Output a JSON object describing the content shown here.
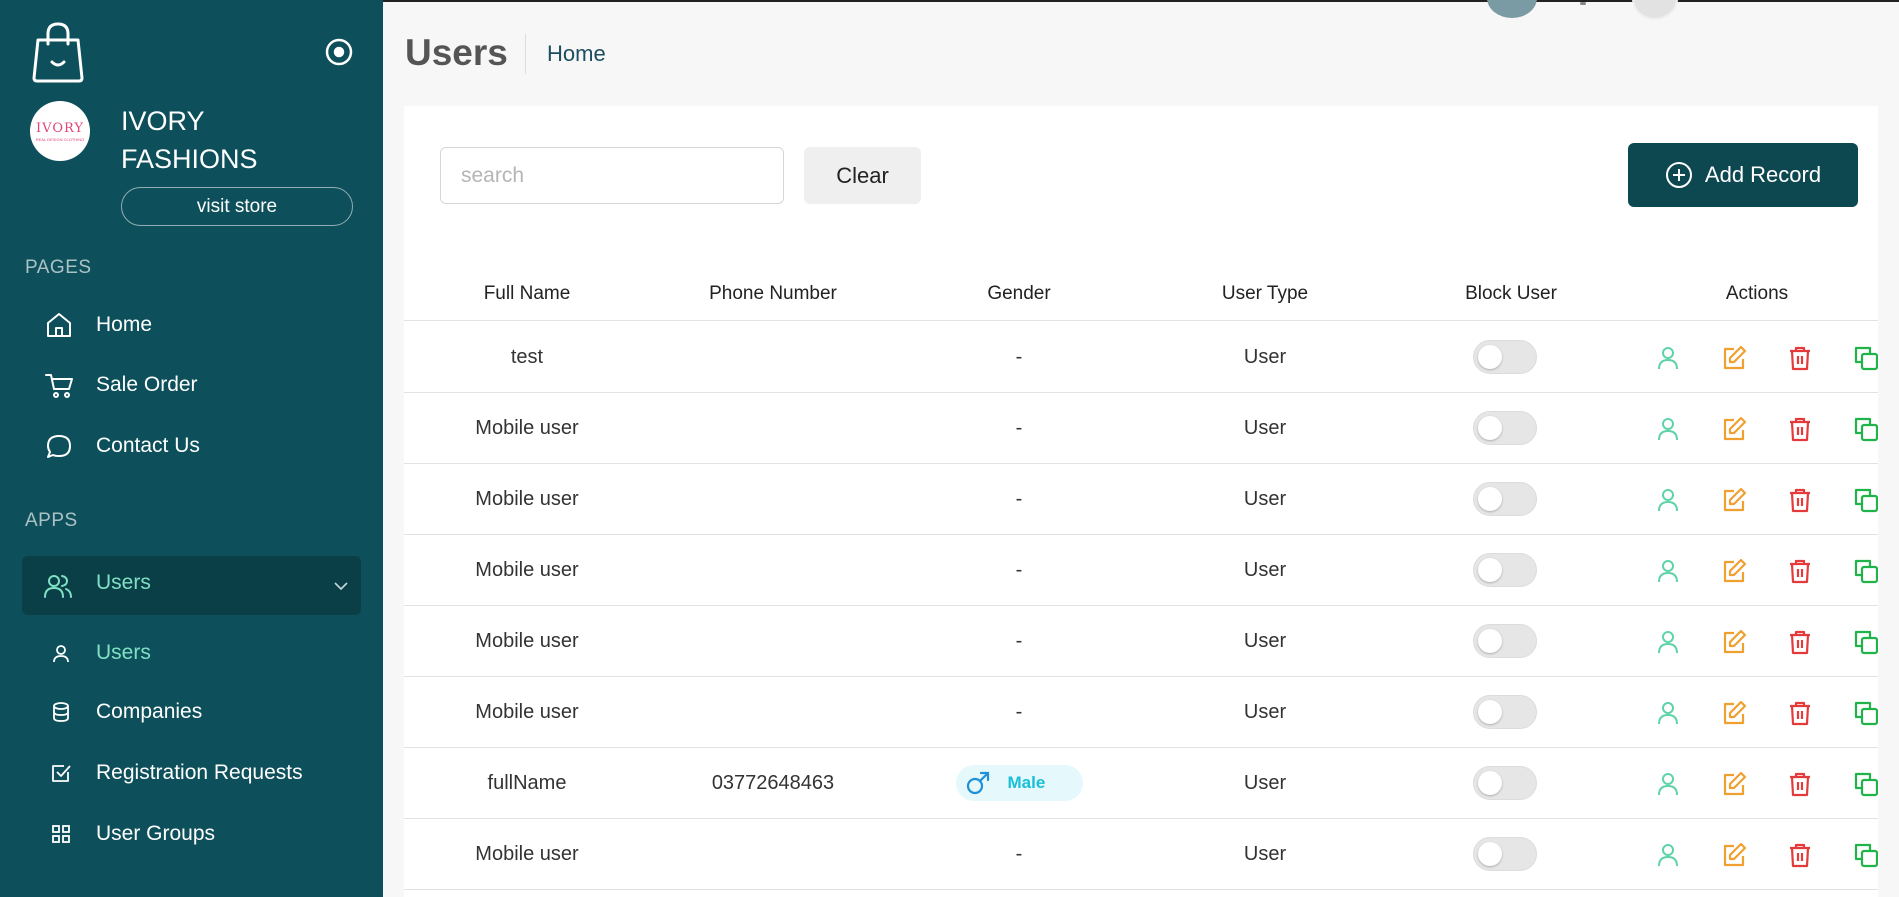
{
  "sidebar": {
    "brand_logo_text": "IVORY",
    "brand_logo_sub": "REAL DESIGN CLOTHING",
    "brand_name": "IVORY FASHIONS",
    "visit_store": "visit store",
    "sections": {
      "pages": "PAGES",
      "apps": "APPS"
    },
    "pages": [
      {
        "label": "Home",
        "icon": "home-icon"
      },
      {
        "label": "Sale Order",
        "icon": "cart-icon"
      },
      {
        "label": "Contact Us",
        "icon": "chat-icon"
      }
    ],
    "apps_group": {
      "label": "Users",
      "icon": "users-icon"
    },
    "apps_sub": [
      {
        "label": "Users",
        "icon": "user-icon",
        "active": true
      },
      {
        "label": "Companies",
        "icon": "database-icon"
      },
      {
        "label": "Registration Requests",
        "icon": "checkbox-icon"
      },
      {
        "label": "User Groups",
        "icon": "grid-icon"
      }
    ]
  },
  "header": {
    "title": "Users",
    "breadcrumb": "Home"
  },
  "toolbar": {
    "search_placeholder": "search",
    "search_value": "",
    "clear_label": "Clear",
    "add_label": "Add Record"
  },
  "table": {
    "columns": [
      "Full Name",
      "Phone Number",
      "Gender",
      "User Type",
      "Block User",
      "Actions"
    ],
    "rows": [
      {
        "name": "test",
        "phone": "",
        "gender": "-",
        "type": "User",
        "blocked": false
      },
      {
        "name": "Mobile user",
        "phone": "",
        "gender": "-",
        "type": "User",
        "blocked": false
      },
      {
        "name": "Mobile user",
        "phone": "",
        "gender": "-",
        "type": "User",
        "blocked": false
      },
      {
        "name": "Mobile user",
        "phone": "",
        "gender": "-",
        "type": "User",
        "blocked": false
      },
      {
        "name": "Mobile user",
        "phone": "",
        "gender": "-",
        "type": "User",
        "blocked": false
      },
      {
        "name": "Mobile user",
        "phone": "",
        "gender": "-",
        "type": "User",
        "blocked": false
      },
      {
        "name": "fullName",
        "phone": "03772648463",
        "gender": "Male",
        "type": "User",
        "blocked": false
      },
      {
        "name": "Mobile user",
        "phone": "",
        "gender": "-",
        "type": "User",
        "blocked": false
      }
    ]
  },
  "colors": {
    "sidebar_bg": "#0d4f5a",
    "accent": "#0d4850",
    "active_text": "#7fe0c3",
    "view_icon": "#5fd3a8",
    "edit_icon": "#f0a030",
    "delete_icon": "#e33b3b",
    "copy_icon": "#1fb34a"
  }
}
